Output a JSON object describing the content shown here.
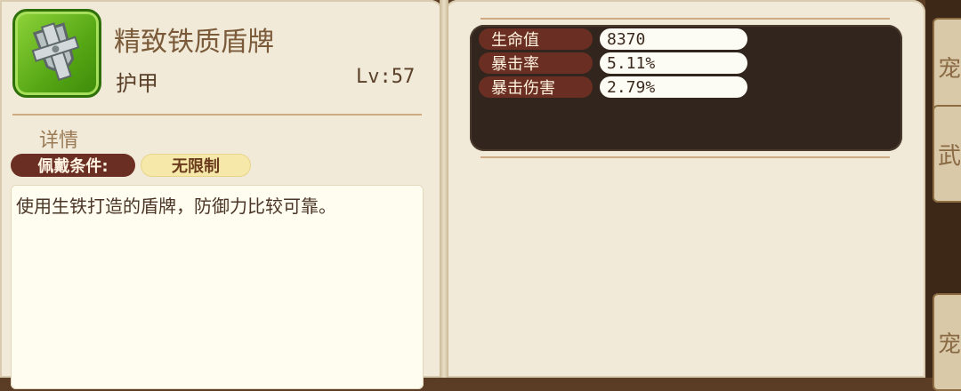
{
  "item": {
    "name": "精致铁质盾牌",
    "type": "护甲",
    "level": "Lv:57",
    "icon": "iron-shield-icon"
  },
  "details": {
    "section_title": "详情",
    "requirement_label": "佩戴条件:",
    "requirement_value": "无限制",
    "description": "使用生铁打造的盾牌，防御力比较可靠。"
  },
  "stats": [
    {
      "name": "生命值",
      "value": "8370"
    },
    {
      "name": "暴击率",
      "value": "5.11%"
    },
    {
      "name": "暴击伤害",
      "value": "2.79%"
    }
  ],
  "side_tabs": [
    "宠",
    "武",
    "宠"
  ],
  "colors": {
    "page_bg": "#f1ead9",
    "stat_label_bg": "#6a2f22",
    "stats_panel_bg": "#31251d",
    "icon_green": "#55a614",
    "requirement_badge": "#f6e8a9"
  }
}
